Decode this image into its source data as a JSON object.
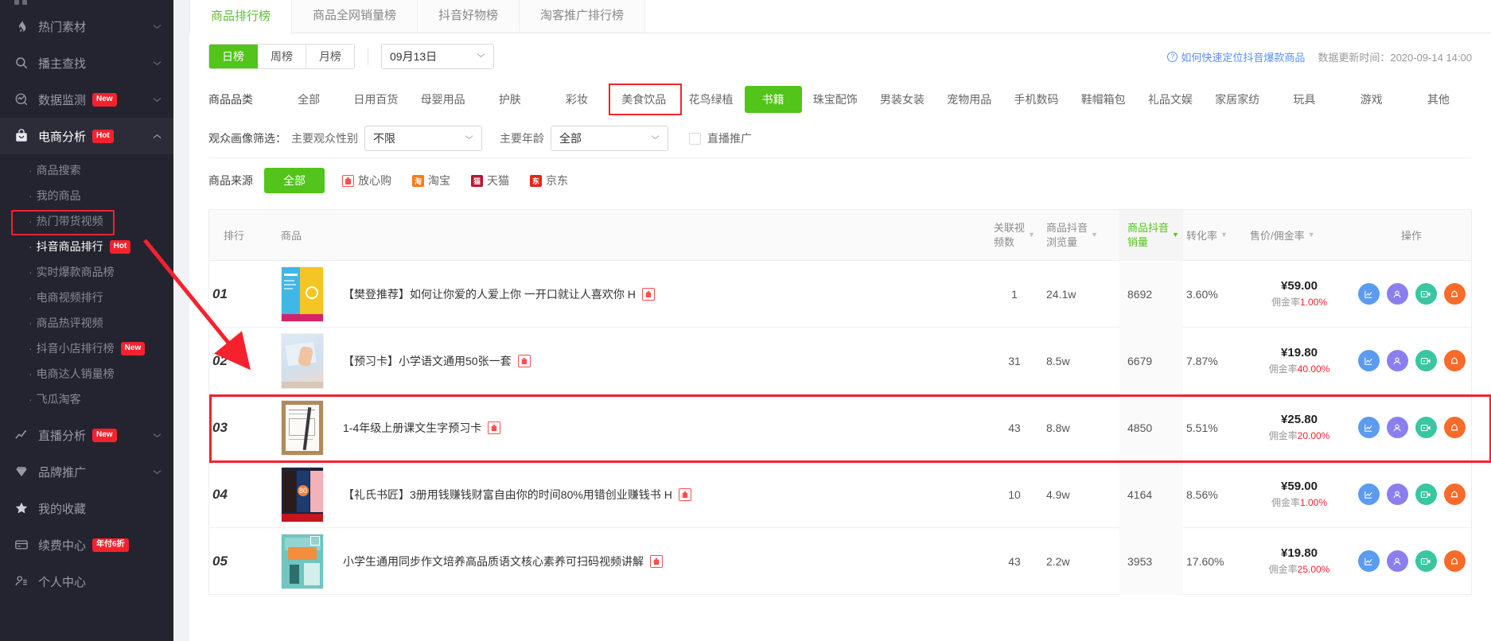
{
  "sidebar": {
    "groups": [
      {
        "label": "热门素材",
        "icon": "fire-icon",
        "badge": null,
        "expanded": false
      },
      {
        "label": "播主查找",
        "icon": "search-icon",
        "badge": null,
        "expanded": false
      },
      {
        "label": "数据监测",
        "icon": "monitor-icon",
        "badge": "New",
        "expanded": false
      },
      {
        "label": "电商分析",
        "icon": "shop-bag-icon",
        "badge": "Hot",
        "expanded": true
      }
    ],
    "ecommerce_children": [
      {
        "label": "商品搜索",
        "badge": null,
        "current": false
      },
      {
        "label": "我的商品",
        "badge": null,
        "current": false
      },
      {
        "label": "热门带货视频",
        "badge": null,
        "current": false
      },
      {
        "label": "抖音商品排行",
        "badge": "Hot",
        "current": true
      },
      {
        "label": "实时爆款商品榜",
        "badge": null,
        "current": false
      },
      {
        "label": "电商视频排行",
        "badge": null,
        "current": false
      },
      {
        "label": "商品热评视频",
        "badge": null,
        "current": false
      },
      {
        "label": "抖音小店排行榜",
        "badge": "New",
        "current": false
      },
      {
        "label": "电商达人销量榜",
        "badge": null,
        "current": false
      },
      {
        "label": "飞瓜淘客",
        "badge": null,
        "current": false
      }
    ],
    "bottom_items": [
      {
        "label": "直播分析",
        "icon": "line-chart-icon",
        "badge": "New",
        "chevron": true
      },
      {
        "label": "品牌推广",
        "icon": "diamond-icon",
        "badge": null,
        "chevron": true
      },
      {
        "label": "我的收藏",
        "icon": "star-icon",
        "badge": null,
        "chevron": false
      },
      {
        "label": "续费中心",
        "icon": "card-icon",
        "badge": "年付6折",
        "chevron": false
      },
      {
        "label": "个人中心",
        "icon": "user-icon",
        "badge": null,
        "chevron": false
      }
    ]
  },
  "tabs": [
    {
      "label": "商品排行榜",
      "active": true
    },
    {
      "label": "商品全网销量榜",
      "active": false
    },
    {
      "label": "抖音好物榜",
      "active": false
    },
    {
      "label": "淘客推广排行榜",
      "active": false
    }
  ],
  "rank_type": {
    "options": [
      {
        "label": "日榜",
        "on": true
      },
      {
        "label": "周榜",
        "on": false
      },
      {
        "label": "月榜",
        "on": false
      }
    ],
    "date_value": "09月13日"
  },
  "header_right": {
    "help_link": "如何快速定位抖音爆款商品",
    "update_label": "数据更新时间：",
    "update_time": "2020-09-14 14:00"
  },
  "category_filter": {
    "label": "商品品类",
    "items": [
      {
        "label": "全部",
        "on": false
      },
      {
        "label": "日用百货",
        "on": false
      },
      {
        "label": "母婴用品",
        "on": false
      },
      {
        "label": "护肤",
        "on": false
      },
      {
        "label": "彩妆",
        "on": false
      },
      {
        "label": "美食饮品",
        "on": false
      },
      {
        "label": "花鸟绿植",
        "on": false
      },
      {
        "label": "书籍",
        "on": true
      },
      {
        "label": "珠宝配饰",
        "on": false
      },
      {
        "label": "男装女装",
        "on": false
      },
      {
        "label": "宠物用品",
        "on": false
      },
      {
        "label": "手机数码",
        "on": false
      },
      {
        "label": "鞋帽箱包",
        "on": false
      },
      {
        "label": "礼品文娱",
        "on": false
      },
      {
        "label": "家居家纺",
        "on": false
      },
      {
        "label": "玩具",
        "on": false
      },
      {
        "label": "游戏",
        "on": false
      },
      {
        "label": "其他",
        "on": false
      }
    ]
  },
  "audience_filter": {
    "label": "观众画像筛选：",
    "gender_label": "主要观众性别",
    "gender_value": "不限",
    "age_label": "主要年龄",
    "age_value": "全部",
    "live_promo_label": "直播推广",
    "live_promo_checked": false
  },
  "source_filter": {
    "label": "商品来源",
    "all_label": "全部",
    "items": [
      {
        "label": "放心购",
        "icon": "fangxingou-icon",
        "color": "#ff4d4f"
      },
      {
        "label": "淘宝",
        "icon": "taobao-icon",
        "color": "#ff7a18"
      },
      {
        "label": "天猫",
        "icon": "tmall-icon",
        "color": "#c41230"
      },
      {
        "label": "京东",
        "icon": "jd-icon",
        "color": "#e1251b"
      }
    ]
  },
  "table": {
    "columns": [
      {
        "key": "rank",
        "label": "排行",
        "sortable": false,
        "highlight": false
      },
      {
        "key": "product",
        "label": "商品",
        "sortable": false,
        "highlight": false
      },
      {
        "key": "video_count",
        "label": "关联视\n频数",
        "line1": "关联视",
        "line2": "频数",
        "sortable": true,
        "highlight": false
      },
      {
        "key": "views",
        "label": "商品抖音浏览量",
        "line1": "商品抖音",
        "line2": "浏览量",
        "sortable": true,
        "highlight": false
      },
      {
        "key": "sales",
        "label": "商品抖音销量",
        "line1": "商品抖音",
        "line2": "销量",
        "sortable": true,
        "highlight": true
      },
      {
        "key": "conversion",
        "label": "转化率",
        "sortable": true,
        "highlight": false
      },
      {
        "key": "price",
        "label": "售价/佣金率",
        "sortable": true,
        "highlight": false
      },
      {
        "key": "actions",
        "label": "操作",
        "sortable": false,
        "highlight": false
      }
    ],
    "commission_prefix": "佣金率",
    "rows": [
      {
        "rank": "01",
        "name": "【樊登推荐】如何让你爱的人爱上你 一开口就让人喜欢你 H",
        "source_tag": "fangxingou-icon",
        "video_count": "1",
        "views": "24.1w",
        "sales": "8692",
        "conversion": "3.60%",
        "price": "¥59.00",
        "commission": "1.00%",
        "thumb": "book-blue-yellow",
        "highlighted": false
      },
      {
        "rank": "02",
        "name": "【预习卡】小学语文通用50张一套",
        "source_tag": "fangxingou-icon",
        "video_count": "31",
        "views": "8.5w",
        "sales": "6679",
        "conversion": "7.87%",
        "price": "¥19.80",
        "commission": "40.00%",
        "thumb": "hand-writing",
        "highlighted": true
      },
      {
        "rank": "03",
        "name": "1-4年级上册课文生字预习卡",
        "source_tag": "fangxingou-icon",
        "video_count": "43",
        "views": "8.8w",
        "sales": "4850",
        "conversion": "5.51%",
        "price": "¥25.80",
        "commission": "20.00%",
        "thumb": "worksheet-pencil",
        "highlighted": false
      },
      {
        "rank": "04",
        "name": "【礼氏书匠】3册用钱赚钱财富自由你的时间80%用错创业赚钱书 H",
        "source_tag": "fangxingou-icon",
        "video_count": "10",
        "views": "4.9w",
        "sales": "4164",
        "conversion": "8.56%",
        "price": "¥59.00",
        "commission": "1.00%",
        "thumb": "book-stack-dark",
        "highlighted": false
      },
      {
        "rank": "05",
        "name": "小学生通用同步作文培养高品质语文核心素养可扫码视频讲解",
        "source_tag": "fangxingou-icon",
        "video_count": "43",
        "views": "2.2w",
        "sales": "3953",
        "conversion": "17.60%",
        "price": "¥19.80",
        "commission": "25.00%",
        "thumb": "book-teal",
        "highlighted": false
      }
    ],
    "action_buttons": [
      {
        "name": "trend-chart-icon",
        "color": "#5b9bf0"
      },
      {
        "name": "person-icon",
        "color": "#8b7ff0"
      },
      {
        "name": "video-icon",
        "color": "#3ac6a0"
      },
      {
        "name": "alert-icon",
        "color": "#fa6a28"
      }
    ]
  },
  "annotations": {
    "accent_red": "#f5222d",
    "accent_green": "#52c41a"
  }
}
